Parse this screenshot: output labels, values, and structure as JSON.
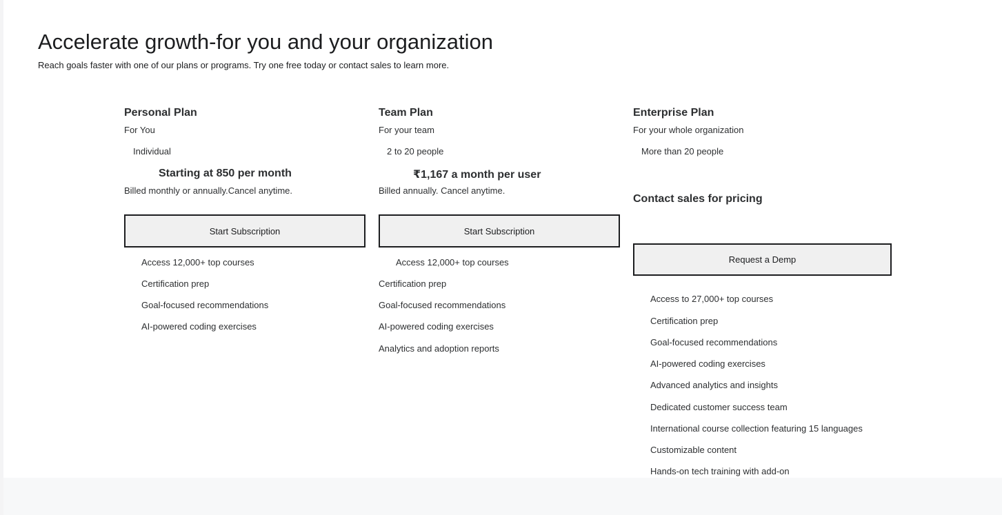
{
  "hero": {
    "title": "Accelerate growth-for you and your organization",
    "subtitle": "Reach goals faster with one of our plans or programs. Try one free today or contact sales to learn more."
  },
  "plans": [
    {
      "name": "Personal Plan",
      "audience": "For You",
      "size": "Individual",
      "price": "Starting at 850 per month",
      "billing": "Billed monthly or annually.Cancel anytime.",
      "cta": "Start Subscription",
      "features": [
        "Access 12,000+ top courses",
        "Certification prep",
        "Goal-focused recommendations",
        "AI-powered coding exercises"
      ]
    },
    {
      "name": "Team Plan",
      "audience": "For your team",
      "size": "2 to 20 people",
      "price": "₹1,167 a month per user",
      "billing": "Billed annually. Cancel anytime.",
      "cta": "Start Subscription",
      "features": [
        "Access 12,000+ top courses",
        "Certification prep",
        "Goal-focused recommendations",
        "AI-powered coding exercises",
        "Analytics and adoption reports"
      ]
    },
    {
      "name": "Enterprise Plan",
      "audience": "For your whole organization",
      "size": "More than 20 people",
      "contact": "Contact sales for pricing",
      "cta": "Request a Demp",
      "features": [
        "Access to 27,000+ top courses",
        "Certification prep",
        "Goal-focused recommendations",
        "AI-powered coding exercises",
        "Advanced analytics and insights",
        "Dedicated customer success team",
        "International course collection featuring 15 languages",
        "Customizable content",
        "Hands-on tech training with add-on"
      ]
    }
  ],
  "colors": {
    "text": "#1c1d1f",
    "button_bg": "#f0f0f0",
    "button_border": "#1c1d1f",
    "band": "#f7f8f9"
  }
}
